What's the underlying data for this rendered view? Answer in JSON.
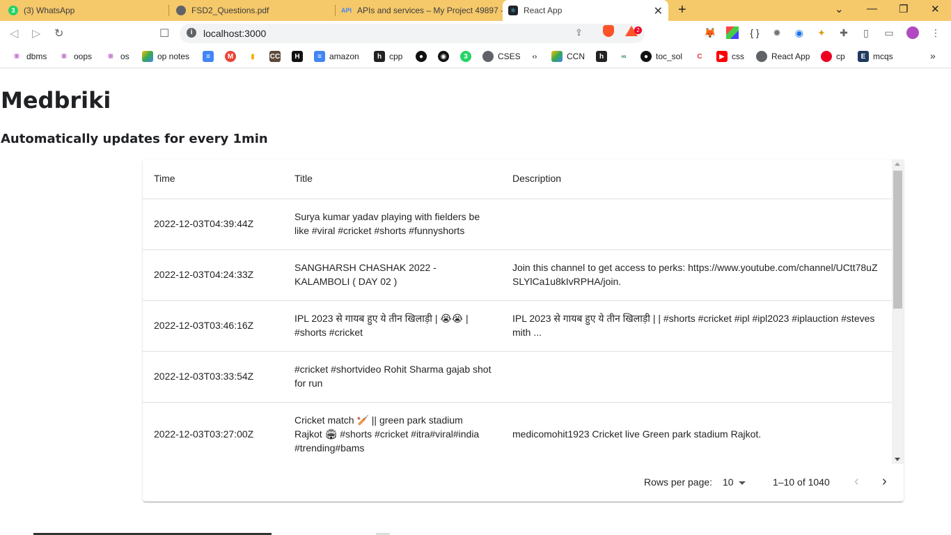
{
  "tabs": [
    {
      "label": "(3) WhatsApp",
      "icon": "whatsapp-icon"
    },
    {
      "label": "FSD2_Questions.pdf",
      "icon": "globe-icon"
    },
    {
      "label": "APIs and services – My Project 49897 –",
      "icon": "api-icon"
    },
    {
      "label": "React App",
      "icon": "react-icon"
    }
  ],
  "omnibox": {
    "url": "localhost:3000"
  },
  "extensions": {
    "brave_rewards_count": "2"
  },
  "bookmarks": [
    "dbms",
    "oops",
    "os",
    "op notes",
    "amazon",
    "cpp",
    "CSES",
    "CCN",
    "toc_sol",
    "css",
    "React App",
    "cp",
    "mcqs"
  ],
  "page": {
    "title": "Medbriki",
    "subtitle": "Automatically updates for every 1min"
  },
  "table": {
    "headers": {
      "time": "Time",
      "title": "Title",
      "description": "Description"
    },
    "rows": [
      {
        "time": "2022-12-03T04:39:44Z",
        "title": "Surya kumar yadav playing with fielders be like #viral #cricket #shorts #funnyshorts",
        "description": ""
      },
      {
        "time": "2022-12-03T04:24:33Z",
        "title": "SANGHARSH CHASHAK 2022 - KALAMBOLI ( DAY 02 )",
        "description": "Join this channel to get access to perks: https://www.youtube.com/channel/UCtt78uZSLYlCa1u8kIvRPHA/join."
      },
      {
        "time": "2022-12-03T03:46:16Z",
        "title": "IPL 2023 से गायब हुए ये तीन खिलाड़ी | 😭😭 | #shorts #cricket",
        "description": "IPL 2023 से गायब हुए ये तीन खिलाड़ी | | #shorts #cricket #ipl #ipl2023 #iplauction #stevesmith ..."
      },
      {
        "time": "2022-12-03T03:33:54Z",
        "title": "#cricket #shortvideo Rohit Sharma gajab shot for run",
        "description": ""
      },
      {
        "time": "2022-12-03T03:27:00Z",
        "title": "Cricket match 🏏 || green park stadium Rajkot 🏟 #shorts #cricket #itra#viral#india #trending#bams",
        "description": "medicomohit1923 Cricket live Green park stadium Rajkot."
      }
    ]
  },
  "pagination": {
    "rows_per_page_label": "Rows per page:",
    "rows_per_page_value": "10",
    "range": "1–10 of 1040"
  }
}
